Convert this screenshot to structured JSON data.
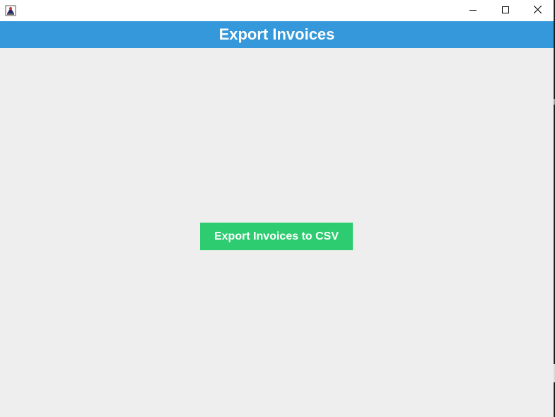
{
  "window": {
    "app_icon": "java-app-icon",
    "controls": {
      "minimize_icon": "minimize-icon",
      "maximize_icon": "maximize-icon",
      "close_icon": "close-icon"
    }
  },
  "header": {
    "title": "Export Invoices",
    "background_color": "#3498db",
    "text_color": "#ffffff"
  },
  "main": {
    "export_button_label": "Export Invoices to CSV",
    "export_button_color": "#2ecc71",
    "background_color": "#eeeeee"
  }
}
